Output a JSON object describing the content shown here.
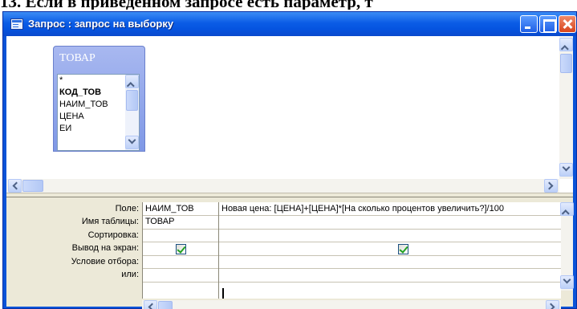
{
  "caption": "13. Если в приведенном запросе есть параметр, т",
  "window": {
    "title": "Запрос : запрос на выборку",
    "buttons": {
      "minimize": "minimize",
      "maximize": "maximize",
      "close": "close"
    }
  },
  "field_list": {
    "table_name": "ТОВАР",
    "items": [
      {
        "label": "*",
        "key": false
      },
      {
        "label": "КОД_ТОВ",
        "key": true
      },
      {
        "label": "НАИМ_ТОВ",
        "key": false
      },
      {
        "label": "ЦЕНА",
        "key": false
      },
      {
        "label": "ЕИ",
        "key": false
      }
    ]
  },
  "grid": {
    "row_labels": [
      "Поле:",
      "Имя таблицы:",
      "Сортировка:",
      "Вывод на экран:",
      "Условие отбора:",
      "или:"
    ],
    "columns": [
      {
        "field": "НАИМ_ТОВ",
        "table": "ТОВАР",
        "sort": "",
        "show": true,
        "criteria": "",
        "or": ""
      },
      {
        "field": "Новая цена: [ЦЕНА]+[ЦЕНА]*[На сколько процентов увеличить?]/100",
        "table": "",
        "sort": "",
        "show": true,
        "criteria": "",
        "or": ""
      }
    ]
  },
  "colors": {
    "titlebar": "#0b5ce6",
    "client": "#ece9d8",
    "check": "#21a121"
  },
  "icons": {
    "window_icon": "query-window-icon",
    "scroll_up": "chevron-up-icon",
    "scroll_down": "chevron-down-icon",
    "scroll_left": "chevron-left-icon",
    "scroll_right": "chevron-right-icon"
  }
}
